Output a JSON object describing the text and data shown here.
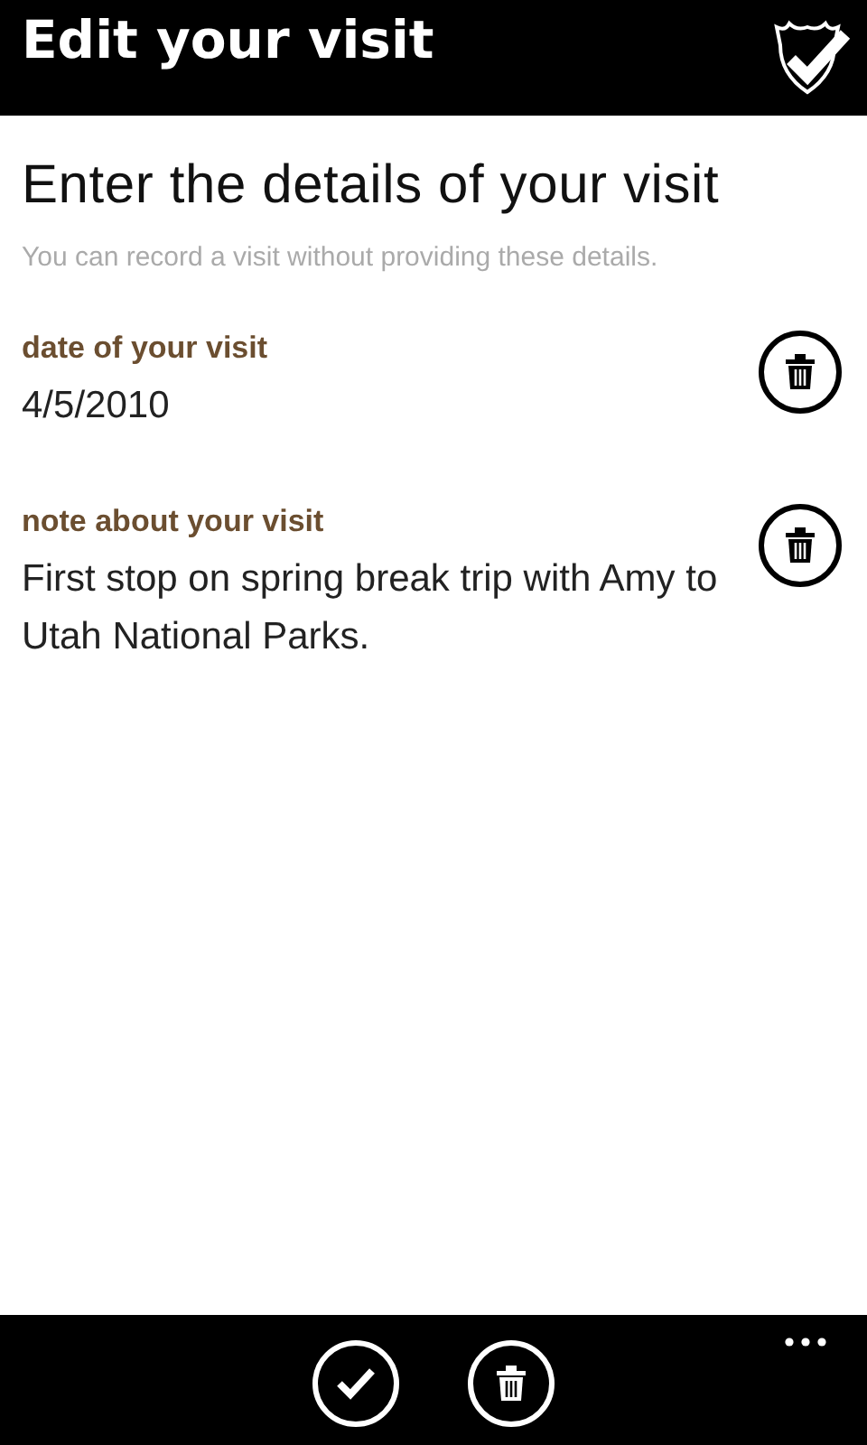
{
  "header": {
    "title": "Edit your visit"
  },
  "heading": "Enter the details of your visit",
  "hint": "You can record a visit without providing these details.",
  "fields": [
    {
      "label": "date of your visit",
      "value": "4/5/2010"
    },
    {
      "label": "note about your visit",
      "value": "First stop on spring break trip with Amy to Utah National Parks."
    }
  ],
  "app_bar": {
    "buttons": [
      {
        "kind": "confirm"
      },
      {
        "kind": "delete"
      }
    ]
  }
}
